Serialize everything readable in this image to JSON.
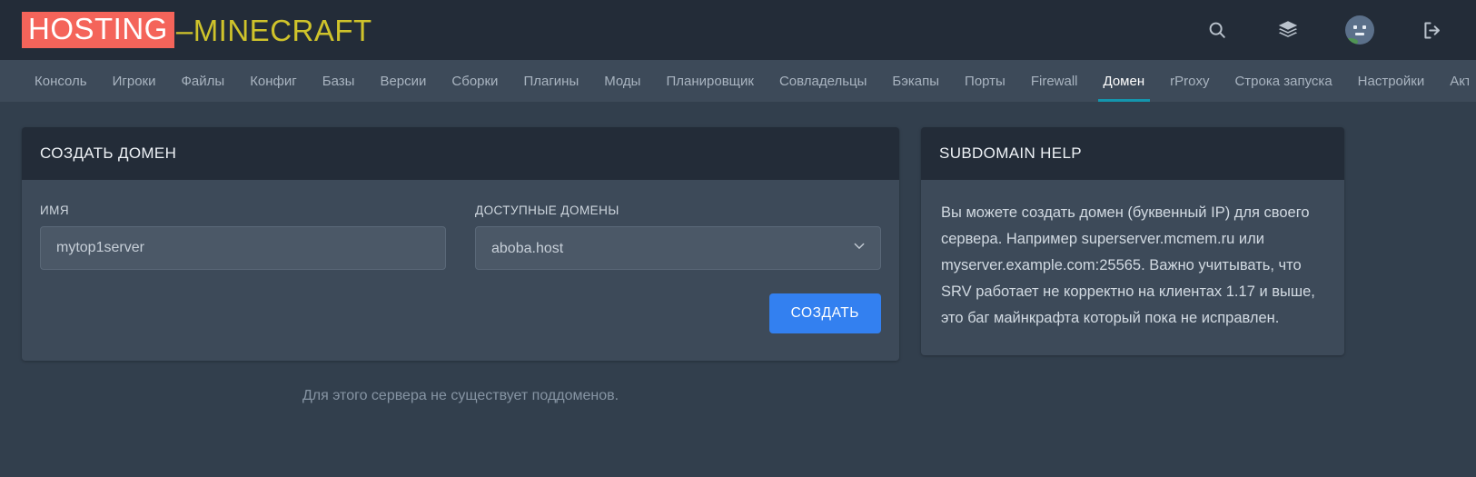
{
  "brand": {
    "highlight": "HOSTING",
    "rest": "–MINECRAFT",
    "highlight_color": "#f4645a",
    "rest_color": "#cfc32b"
  },
  "topbar": {
    "icons": [
      {
        "name": "search-icon",
        "label": "Search"
      },
      {
        "name": "layers-icon",
        "label": "Servers"
      },
      {
        "name": "avatar",
        "label": "Account"
      },
      {
        "name": "logout-icon",
        "label": "Logout"
      }
    ]
  },
  "nav": {
    "active_index": 14,
    "accent_color": "#1495ad",
    "items": [
      {
        "label": "Консоль"
      },
      {
        "label": "Игроки"
      },
      {
        "label": "Файлы"
      },
      {
        "label": "Конфиг"
      },
      {
        "label": "Базы"
      },
      {
        "label": "Версии"
      },
      {
        "label": "Сборки"
      },
      {
        "label": "Плагины"
      },
      {
        "label": "Моды"
      },
      {
        "label": "Планировщик"
      },
      {
        "label": "Совладельцы"
      },
      {
        "label": "Бэкапы"
      },
      {
        "label": "Порты"
      },
      {
        "label": "Firewall"
      },
      {
        "label": "Домен"
      },
      {
        "label": "rProxy"
      },
      {
        "label": "Строка запуска"
      },
      {
        "label": "Настройки"
      },
      {
        "label": "Активность"
      }
    ]
  },
  "create_domain": {
    "header": "СОЗДАТЬ ДОМЕН",
    "name_label": "ИМЯ",
    "name_value": "mytop1server",
    "name_placeholder": "",
    "domains_label": "ДОСТУПНЫЕ ДОМЕНЫ",
    "domains_selected": "aboba.host",
    "domains_options": [
      "aboba.host"
    ],
    "submit_label": "СОЗДАТЬ",
    "submit_color": "#3380f0",
    "empty_note": "Для этого сервера не существует поддоменов."
  },
  "help": {
    "header": "SUBDOMAIN HELP",
    "body": "Вы можете создать домен (буквенный IP) для своего сервера. Например superserver.mcmem.ru или myserver.example.com:25565. Важно учитывать, что SRV работает не корректно на клиентах 1.17 и выше, это баг майнкрафта который пока не исправлен."
  },
  "colors": {
    "page_bg": "#323f4d",
    "topbar_bg": "#232c38",
    "navbar_bg": "#3d4a59",
    "card_header_bg": "#232c38",
    "card_body_bg": "#3d4a59",
    "input_bg": "#4b5867"
  }
}
